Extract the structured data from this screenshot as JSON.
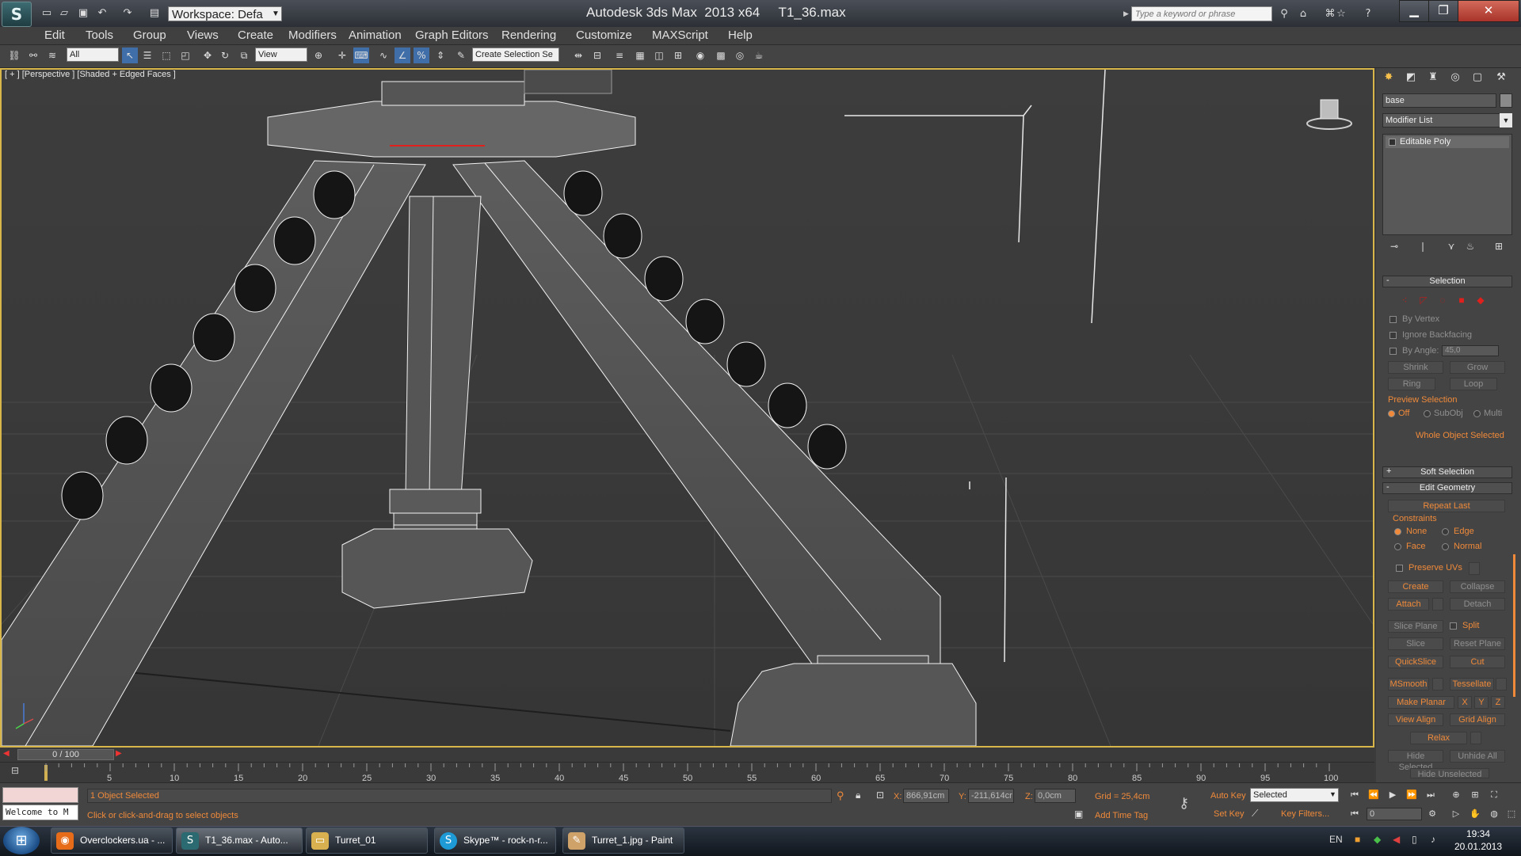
{
  "titlebar": {
    "workspace": "Workspace: Defa",
    "title": "Autodesk 3ds Max  2013 x64     T1_36.max",
    "search_placeholder": "Type a keyword or phrase"
  },
  "menu": [
    "Edit",
    "Tools",
    "Group",
    "Views",
    "Create",
    "Modifiers",
    "Animation",
    "Graph Editors",
    "Rendering",
    "Customize",
    "MAXScript",
    "Help"
  ],
  "toolbar": {
    "selection_filter": "All",
    "ref_coord": "View",
    "named_selection": "Create Selection Se"
  },
  "viewport": {
    "label": "[ + ] [Perspective ] [Shaded + Edged Faces ]"
  },
  "command_panel": {
    "object_name": "base",
    "modifier_list": "Modifier List",
    "stack_item": "Editable Poly",
    "selection": {
      "title": "Selection",
      "by_vertex": "By Vertex",
      "ignore_backfacing": "Ignore Backfacing",
      "by_angle": "By Angle:",
      "angle_value": "45,0",
      "shrink": "Shrink",
      "grow": "Grow",
      "ring": "Ring",
      "loop": "Loop",
      "preview_selection": "Preview Selection",
      "preview_off": "Off",
      "preview_subobj": "SubObj",
      "preview_multi": "Multi",
      "whole_object": "Whole Object Selected"
    },
    "soft_selection": "Soft Selection",
    "edit_geometry": {
      "title": "Edit Geometry",
      "repeat_last": "Repeat Last",
      "constraints": "Constraints",
      "none": "None",
      "edge": "Edge",
      "face": "Face",
      "normal": "Normal",
      "preserve_uvs": "Preserve UVs",
      "create": "Create",
      "collapse": "Collapse",
      "attach": "Attach",
      "detach": "Detach",
      "slice_plane": "Slice Plane",
      "split": "Split",
      "slice": "Slice",
      "reset_plane": "Reset Plane",
      "quickslice": "QuickSlice",
      "cut": "Cut",
      "msmooth": "MSmooth",
      "tessellate": "Tessellate",
      "make_planar": "Make Planar",
      "x": "X",
      "y": "Y",
      "z": "Z",
      "view_align": "View Align",
      "grid_align": "Grid Align",
      "relax": "Relax",
      "hide_selected": "Hide Selected",
      "unhide_all": "Unhide All",
      "hide_unselected": "Hide Unselected"
    }
  },
  "timeline": {
    "slider": "0 / 100",
    "ticks": [
      "5",
      "10",
      "15",
      "20",
      "25",
      "30",
      "35",
      "40",
      "45",
      "50",
      "55",
      "60",
      "65",
      "70",
      "75",
      "80",
      "85",
      "90",
      "95",
      "100"
    ]
  },
  "status": {
    "listener": "Welcome to M",
    "selection_count": "1 Object Selected",
    "prompt": "Click or click-and-drag to select objects",
    "x_label": "X:",
    "x_value": "866,91cm",
    "y_label": "Y:",
    "y_value": "-211,614cr",
    "z_label": "Z:",
    "z_value": "0,0cm",
    "grid": "Grid = 25,4cm",
    "add_time_tag": "Add Time Tag",
    "auto_key": "Auto Key",
    "set_key": "Set Key",
    "key_mode": "Selected",
    "key_filters": "Key Filters...",
    "frame": "0"
  },
  "taskbar": {
    "items": [
      {
        "label": "Overclockers.ua - ...",
        "icon": "firefox-icon"
      },
      {
        "label": "T1_36.max - Auto...",
        "icon": "3dsmax-icon"
      },
      {
        "label": "Turret_01",
        "icon": "folder-icon"
      },
      {
        "label": "Skype™ - rock-n-r...",
        "icon": "skype-icon"
      },
      {
        "label": "Turret_1.jpg - Paint",
        "icon": "paint-icon"
      }
    ],
    "language": "EN",
    "time": "19:34",
    "date": "20.01.2013"
  },
  "colors": {
    "accent_orange": "#f08a3a",
    "viewport_border": "#d9b64a",
    "selection_red": "#e0201c"
  }
}
